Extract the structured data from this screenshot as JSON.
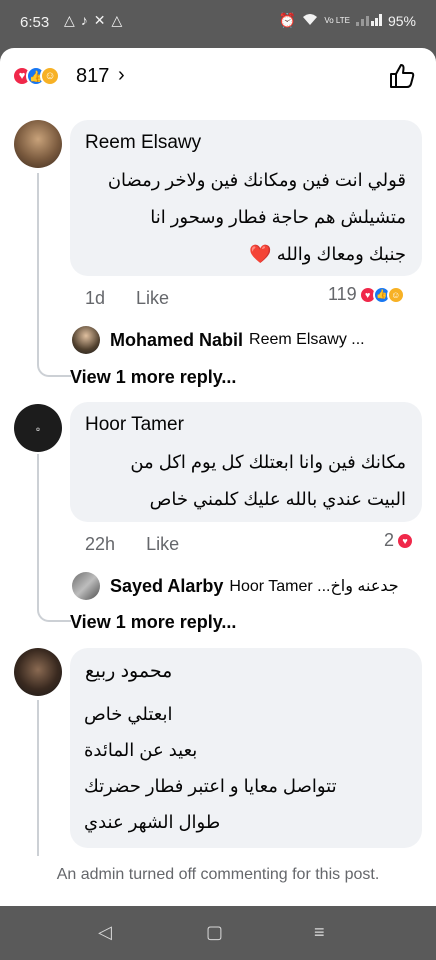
{
  "status_bar": {
    "time": "6:53",
    "left_icons": [
      "tiktok-icon",
      "x-icon",
      "notification-icon"
    ],
    "volte": "Vo LTE",
    "battery": "95%"
  },
  "header": {
    "reaction_count": "817",
    "reactions": [
      "love",
      "like",
      "care"
    ]
  },
  "comments": [
    {
      "author": "Reem Elsawy",
      "lines": [
        "قولي انت فين ومكانك فين ولاخر رمضان",
        "متشيلش هم حاجة فطار وسحور انا",
        "جنبك ومعاك والله ❤️"
      ],
      "time": "1d",
      "like_label": "Like",
      "reaction_count": "119",
      "reply": {
        "author": "Mohamed Nabil",
        "snippet": "Reem Elsawy ..."
      },
      "view_more": "View 1 more reply..."
    },
    {
      "author": "Hoor Tamer",
      "lines": [
        "مكانك فين وانا ابعتلك كل يوم اكل من",
        "البيت عندي بالله عليك كلمني خاص"
      ],
      "time": "22h",
      "like_label": "Like",
      "reaction_count": "2",
      "reply": {
        "author": "Sayed Alarby",
        "snippet": "Hoor Tamer ...جدعنه واخ"
      },
      "view_more": "View 1 more reply..."
    },
    {
      "author": "محمود ربيع",
      "lines": [
        "ابعتلي خاص",
        "بعيد عن المائدة",
        "تتواصل معايا و اعتبر فطار حضرتك",
        "طوال الشهر عندي"
      ]
    }
  ],
  "admin_note": "An admin turned off commenting for this post.",
  "colors": {
    "bubble": "#f0f2f5",
    "love": "#f0284a",
    "like": "#1877f2",
    "care": "#f7b125",
    "meta": "#65676b"
  }
}
